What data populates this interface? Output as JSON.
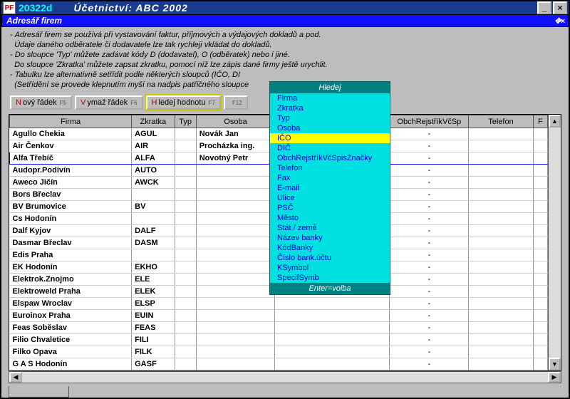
{
  "title": {
    "logo": "PF",
    "code": "20322d",
    "main": "Účetnictví:  ABC 2002"
  },
  "subtitle": "Adresář firem",
  "help": [
    "- Adresář firem se používá při vystavování faktur, příjmových a výdajových dokladů a pod.",
    "  Údaje daného odběratele či dodavatele lze tak rychleji vkládat do dokladů.",
    "- Do sloupce 'Typ' můžete zadávat kódy D (dodavatel), O (odběratek) nebo i jiné.",
    "  Do sloupce 'Zkratka' můžete zapsat zkratku, pomocí níž lze zápis dané firmy ještě urychlit.",
    "- Tabulku lze alternativně setřídit podle některých sloupců (IČO, DI",
    "  (Setřídění se provede klepnutím myší na nadpis patřičného sloupce"
  ],
  "buttons": [
    {
      "hot": "N",
      "rest": "ový řádek",
      "fkey": "F5",
      "name": "new-row-button"
    },
    {
      "hot": "V",
      "rest": "ymaž řádek",
      "fkey": "F6",
      "name": "delete-row-button"
    },
    {
      "hot": "H",
      "rest": "ledej hodnotu",
      "fkey": "F7",
      "name": "search-value-button",
      "hl": true
    },
    {
      "hot": "",
      "rest": "",
      "fkey": "F12",
      "name": "f12-button"
    }
  ],
  "columns": [
    "Firma",
    "Zkratka",
    "Typ",
    "Osoba",
    "",
    "ObchRejstříkVčSp",
    "Telefon",
    "F"
  ],
  "rows": [
    {
      "f": "Agullo Chekia",
      "z": "AGUL",
      "t": "",
      "o": "Novák Jan",
      "d": "-"
    },
    {
      "f": "Air Čenkov",
      "z": "AIR",
      "t": "",
      "o": "Procházka ing.",
      "d": "-"
    },
    {
      "f": "Alfa Třebíč",
      "z": "ALFA",
      "t": "",
      "o": "Novotný Petr",
      "d": "-",
      "blue": true
    },
    {
      "f": "Audopr.Podivín",
      "z": "AUTO",
      "t": "",
      "o": "",
      "d": "-"
    },
    {
      "f": "Aweco Jičín",
      "z": "AWCK",
      "t": "",
      "o": "",
      "d": "-"
    },
    {
      "f": "Bors Břeclav",
      "z": "",
      "t": "",
      "o": "",
      "d": "-"
    },
    {
      "f": "BV Brumovice",
      "z": "BV",
      "t": "",
      "o": "",
      "d": "-"
    },
    {
      "f": "Cs Hodonín",
      "z": "",
      "t": "",
      "o": "",
      "d": "-"
    },
    {
      "f": "Dalf Kyjov",
      "z": "DALF",
      "t": "",
      "o": "",
      "d": "-"
    },
    {
      "f": "Dasmar Břeclav",
      "z": "DASM",
      "t": "",
      "o": "",
      "d": "-"
    },
    {
      "f": "Edis Praha",
      "z": "",
      "t": "",
      "o": "",
      "d": "-"
    },
    {
      "f": "EK Hodonín",
      "z": "EKHO",
      "t": "",
      "o": "",
      "d": "-"
    },
    {
      "f": "Elektrok.Znojmo",
      "z": "ELE",
      "t": "",
      "o": "",
      "d": "-"
    },
    {
      "f": "Elektroweld Praha",
      "z": "ELEK",
      "t": "",
      "o": "",
      "d": "-"
    },
    {
      "f": "Elspaw Wroclav",
      "z": "ELSP",
      "t": "",
      "o": "",
      "d": "-"
    },
    {
      "f": "Euroinox Praha",
      "z": "EUIN",
      "t": "",
      "o": "",
      "d": "-"
    },
    {
      "f": "Feas Soběslav",
      "z": "FEAS",
      "t": "",
      "o": "",
      "d": "-"
    },
    {
      "f": "Filio Chvaletice",
      "z": "FILI",
      "t": "",
      "o": "",
      "d": "-"
    },
    {
      "f": "Filko Opava",
      "z": "FILK",
      "t": "",
      "o": "",
      "d": "-"
    },
    {
      "f": "G A S Hodonín",
      "z": "GASF",
      "t": "",
      "o": "",
      "d": "-"
    }
  ],
  "popup": {
    "header": "Hledej",
    "footer": "Enter=volba",
    "items": [
      "Firma",
      "Zkratka",
      "Typ",
      "Osoba",
      "IČO",
      "DIČ",
      "ObchRejstříkVčSpisZnačky",
      "Telefon",
      "Fax",
      "E-mail",
      "Ulice",
      "PSČ",
      "Město",
      "Stát / země",
      "Název banky",
      "KódBanky",
      "Číslo bank.účtu",
      "KSymbol",
      "SpecifSymb"
    ],
    "selected": 4
  }
}
